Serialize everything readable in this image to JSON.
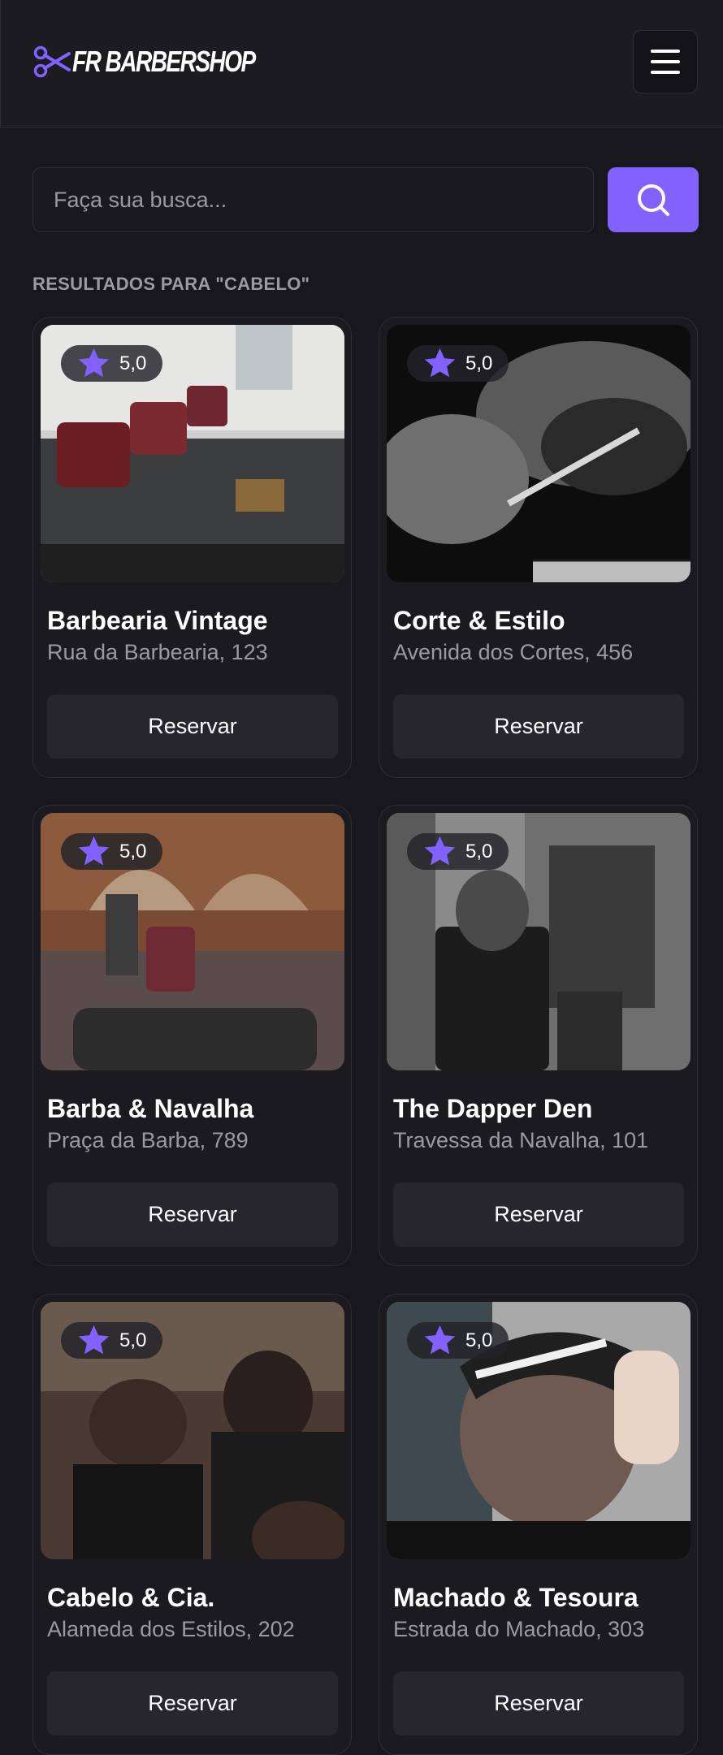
{
  "header": {
    "logo_text": "FR BARBERSHOP",
    "logo_icon": "scissors-icon",
    "menu_icon": "hamburger-menu-icon"
  },
  "search": {
    "placeholder": "Faça sua busca...",
    "value": "",
    "button_icon": "search-icon"
  },
  "results": {
    "title": "RESULTADOS PARA \"CABELO\""
  },
  "colors": {
    "accent": "#8162ff",
    "background": "#17171c",
    "card": "#1a1a1f",
    "muted_text": "#9a9aa3"
  },
  "barbershops": [
    {
      "name": "Barbearia Vintage",
      "address": "Rua da Barbearia, 123",
      "rating": "5,0",
      "button": "Reservar"
    },
    {
      "name": "Corte & Estilo",
      "address": "Avenida dos Cortes, 456",
      "rating": "5,0",
      "button": "Reservar"
    },
    {
      "name": "Barba & Navalha",
      "address": "Praça da Barba, 789",
      "rating": "5,0",
      "button": "Reservar"
    },
    {
      "name": "The Dapper Den",
      "address": "Travessa da Navalha, 101",
      "rating": "5,0",
      "button": "Reservar"
    },
    {
      "name": "Cabelo & Cia.",
      "address": "Alameda dos Estilos, 202",
      "rating": "5,0",
      "button": "Reservar"
    },
    {
      "name": "Machado & Tesoura",
      "address": "Estrada do Machado, 303",
      "rating": "5,0",
      "button": "Reservar"
    }
  ]
}
